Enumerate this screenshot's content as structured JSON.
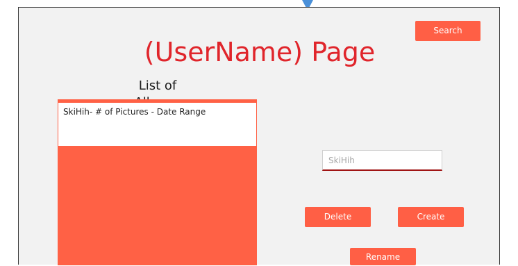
{
  "page": {
    "title": "(UserName) Page"
  },
  "toolbar": {
    "search_label": "Search"
  },
  "albums": {
    "heading": "List of Albums",
    "items": [
      {
        "label": "SkiHih- # of Pictures - Date Range"
      }
    ]
  },
  "album_name": {
    "placeholder": "SkiHih"
  },
  "actions": {
    "delete_label": "Delete",
    "create_label": "Create",
    "rename_label": "Rename"
  },
  "colors": {
    "accent": "#ff5f45",
    "title": "#e0252b",
    "connector": "#4a90d9"
  },
  "icons": {
    "connector": "arrow-down-icon"
  }
}
